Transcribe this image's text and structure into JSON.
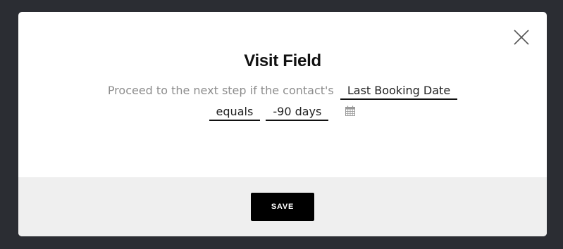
{
  "modal": {
    "title": "Visit Field",
    "close_icon": "close-icon"
  },
  "condition": {
    "prefix": "Proceed to the next step if the contact's",
    "field": "Last Booking Date",
    "operator": "equals",
    "value": "-90 days",
    "calendar_icon": "calendar-icon"
  },
  "footer": {
    "save_label": "SAVE"
  },
  "colors": {
    "backdrop": "#2b2d33",
    "footer_bg": "#efefef",
    "button_bg": "#000000",
    "muted_text": "#8d8d8d"
  }
}
